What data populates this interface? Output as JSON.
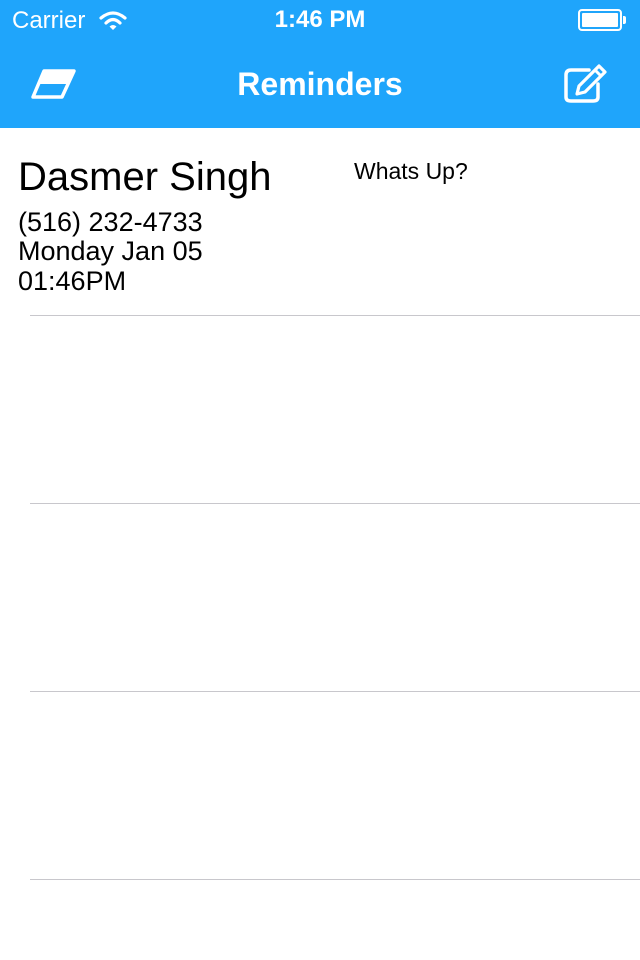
{
  "status_bar": {
    "carrier": "Carrier",
    "time": "1:46 PM"
  },
  "nav": {
    "title": "Reminders",
    "left_icon": "eraser-icon",
    "right_icon": "compose-icon"
  },
  "colors": {
    "header_bg": "#1fa5fb",
    "separator": "#c8c7cc"
  },
  "reminders": [
    {
      "name": "Dasmer Singh",
      "phone": "(516) 232-4733",
      "date": "Monday Jan 05",
      "time": "01:46PM",
      "message": "Whats Up?"
    }
  ]
}
